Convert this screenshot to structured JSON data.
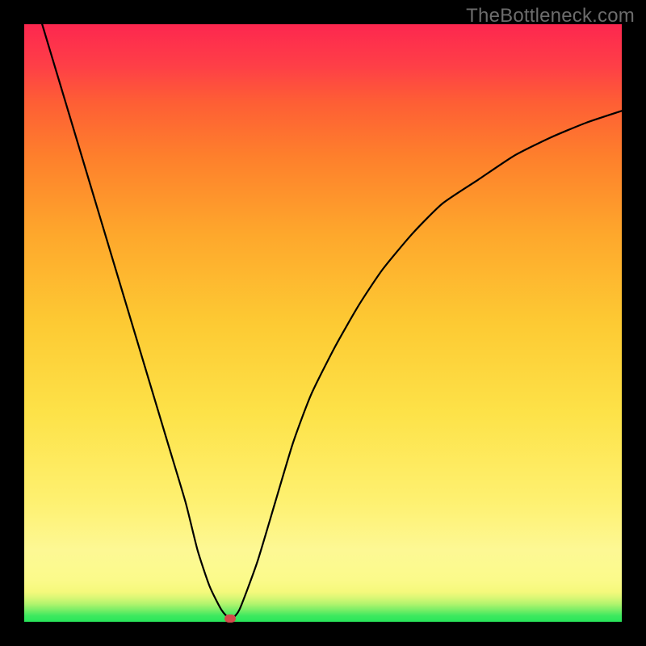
{
  "watermark": "TheBottleneck.com",
  "chart_data": {
    "type": "line",
    "title": "",
    "xlabel": "",
    "ylabel": "",
    "xlim": [
      0,
      100
    ],
    "ylim": [
      0,
      100
    ],
    "grid": false,
    "series": [
      {
        "name": "bottleneck-curve",
        "x": [
          3,
          6,
          9,
          12,
          15,
          18,
          21,
          24,
          27,
          29,
          31,
          33,
          34.5,
          36,
          39,
          42,
          45,
          48,
          52,
          56,
          60,
          65,
          70,
          76,
          82,
          88,
          94,
          100
        ],
        "y": [
          100,
          90,
          80,
          70,
          60,
          50,
          40,
          30,
          20,
          12,
          6,
          2,
          0.5,
          2,
          10,
          20,
          30,
          38,
          46,
          53,
          59,
          65,
          70,
          74,
          78,
          81,
          83.5,
          85.5
        ]
      }
    ],
    "marker": {
      "x": 34.5,
      "y": 0.5,
      "label": "optimum-marker"
    },
    "background_gradient": {
      "top": "#fd274f",
      "mid": "#fde248",
      "bottom": "#28e65a"
    }
  }
}
